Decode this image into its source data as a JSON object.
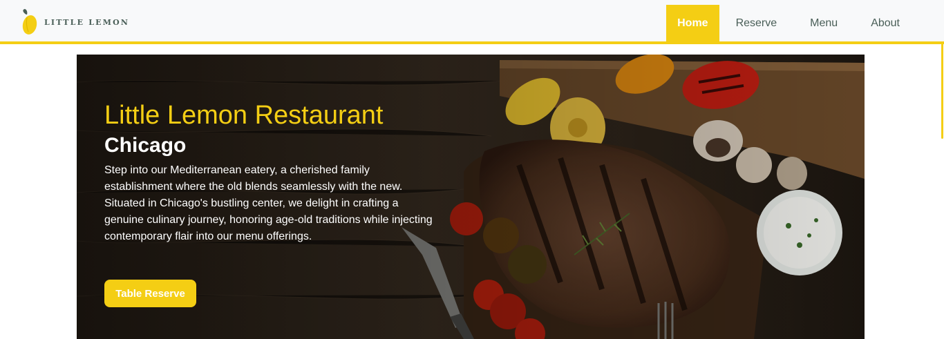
{
  "brand": {
    "name": "LITTLE LEMON",
    "logo_icon": "lemon-logo-icon"
  },
  "nav": {
    "items": [
      {
        "label": "Home",
        "active": true
      },
      {
        "label": "Reserve",
        "active": false
      },
      {
        "label": "Menu",
        "active": false
      },
      {
        "label": "About",
        "active": false
      }
    ]
  },
  "hero": {
    "title": "Little Lemon Restaurant",
    "subtitle": "Chicago",
    "description": "Step into our Mediterranean eatery, a cherished family establishment where the old blends seamlessly with the new. Situated in Chicago's bustling center, we delight in crafting a genuine culinary journey, honoring age-old traditions while injecting contemporary flair into our menu offerings.",
    "button_label": "Table Reserve",
    "image": "grilled-steak-vegetables-image"
  },
  "colors": {
    "accent": "#f4ce14",
    "brand_green": "#495e57",
    "navbar_bg": "#f8f9fa"
  }
}
